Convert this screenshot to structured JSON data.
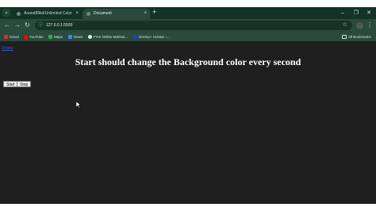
{
  "browser": {
    "tabs": [
      {
        "title": "Anand89kd/Unlimited Color",
        "close": "×"
      },
      {
        "title": "Document",
        "close": "×"
      }
    ],
    "tab_search_icon": "chevron-down-icon",
    "new_tab": "+",
    "window_controls": {
      "minimize": "–",
      "restore": "❐",
      "close": "✕"
    },
    "nav": {
      "back": "←",
      "forward": "→",
      "reload": "↻"
    },
    "address": {
      "url": "127.0.0.1:5500",
      "info": "ⓘ",
      "star": "☆"
    },
    "menu": "⋮"
  },
  "bookmarks": {
    "items": [
      {
        "label": "Gmail",
        "color": "#d93025"
      },
      {
        "label": "YouTube",
        "color": "#ff0000"
      },
      {
        "label": "Maps",
        "color": "#34a853"
      },
      {
        "label": "News",
        "color": "#4285f4"
      },
      {
        "label": "Free Online Marketi...",
        "color": "#e8e8e8"
      },
      {
        "label": "Disney+ Hotstar -...",
        "color": "#1f3fbf"
      }
    ],
    "all_bookmarks": "All Bookmarks"
  },
  "page": {
    "link": "Home",
    "heading": "Start should change the Background color every second",
    "buttons": {
      "start": "Start",
      "stop": "Stop"
    }
  }
}
